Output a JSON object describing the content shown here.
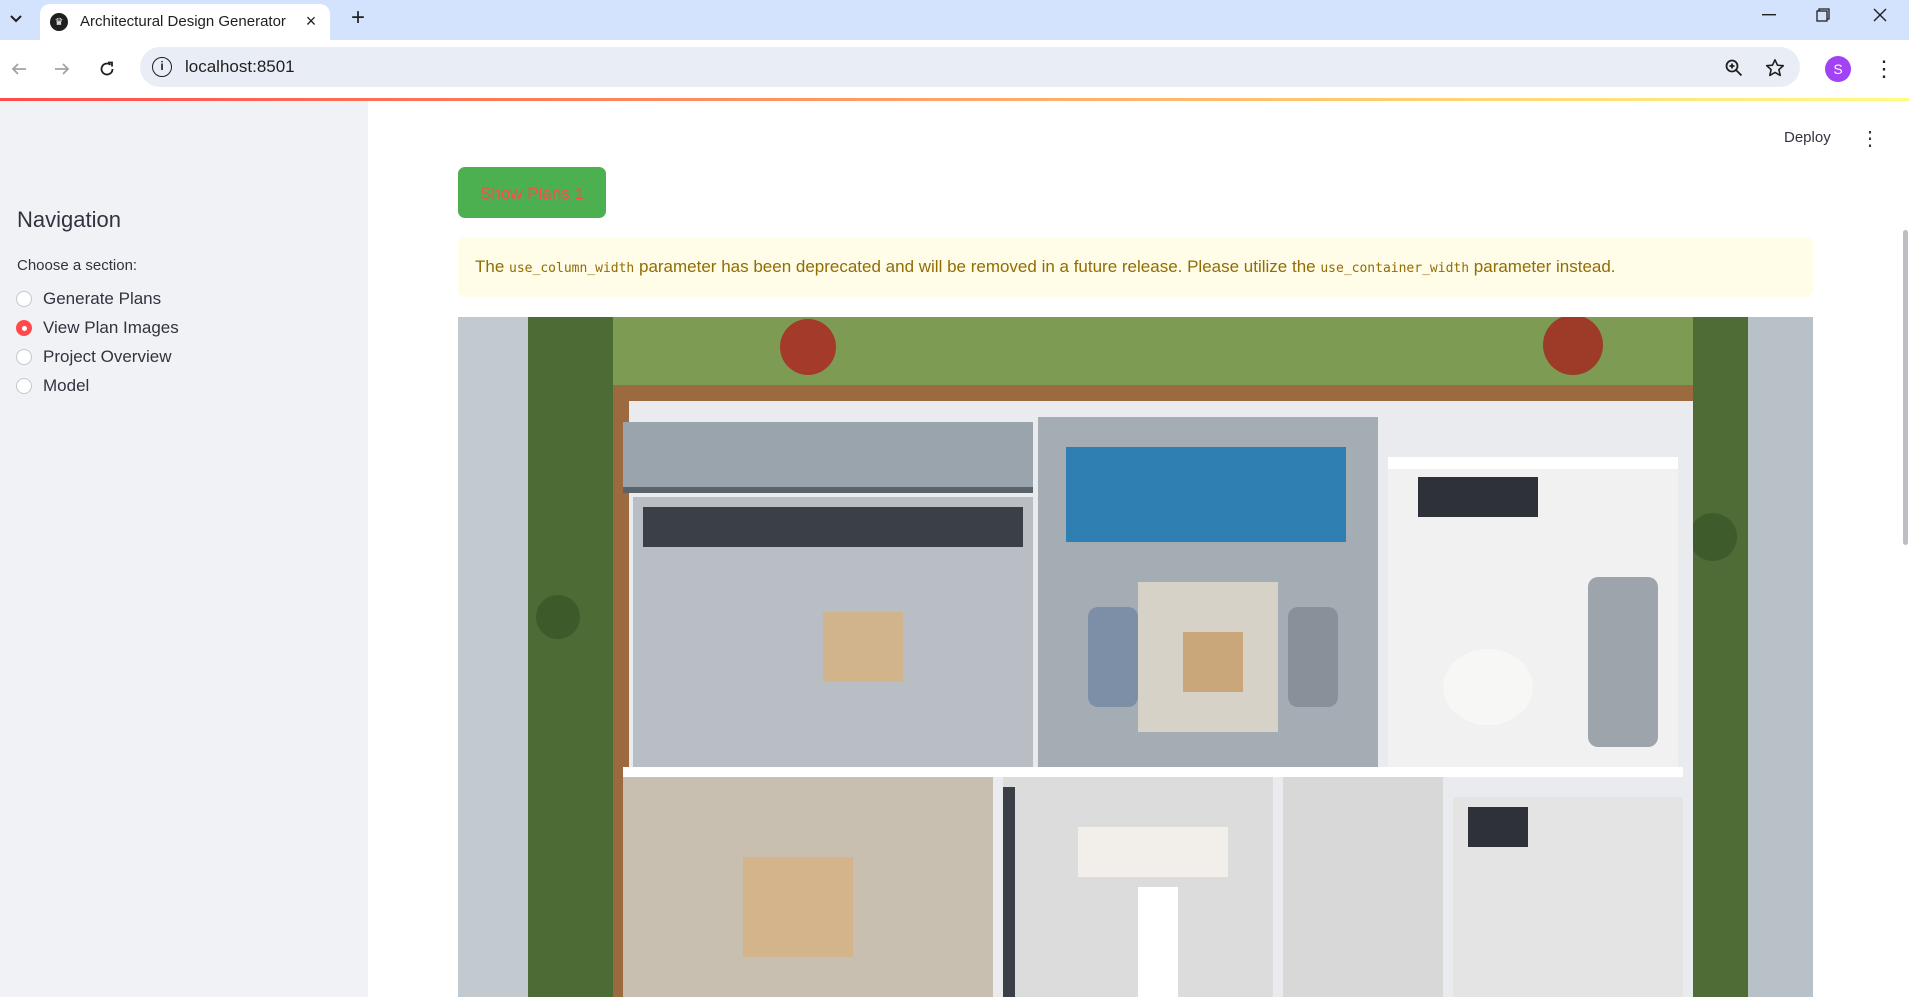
{
  "browser": {
    "tab_title": "Architectural Design Generator",
    "tab_close": "×",
    "new_tab": "+",
    "url": "localhost:8501",
    "profile_initial": "S",
    "icons": [
      "tab-search-icon",
      "app-favicon",
      "close-icon",
      "plus-icon",
      "back-icon",
      "forward-icon",
      "reload-icon",
      "site-info-icon",
      "zoom-icon",
      "star-icon",
      "more-vert-icon",
      "minimize-icon",
      "restore-icon",
      "window-close-icon"
    ]
  },
  "sidebar": {
    "title": "Navigation",
    "radio_label": "Choose a section:",
    "options": [
      {
        "label": "Generate Plans",
        "selected": false
      },
      {
        "label": "View Plan Images",
        "selected": true
      },
      {
        "label": "Project Overview",
        "selected": false
      },
      {
        "label": "Model",
        "selected": false
      }
    ]
  },
  "header": {
    "deploy_label": "Deploy"
  },
  "main": {
    "show_button_label": "Show Plans 1",
    "warning": {
      "prefix": "The ",
      "code1": "use_column_width",
      "middle": " parameter has been deprecated and will be removed in a future release. Please utilize the ",
      "code2": "use_container_width",
      "suffix": " parameter instead."
    }
  },
  "colors": {
    "accent": "#ff4b4b",
    "button_bg": "#4caf50",
    "warning_bg": "#fffce7",
    "warning_text": "#926c05",
    "sidebar_bg": "#f0f2f6"
  }
}
